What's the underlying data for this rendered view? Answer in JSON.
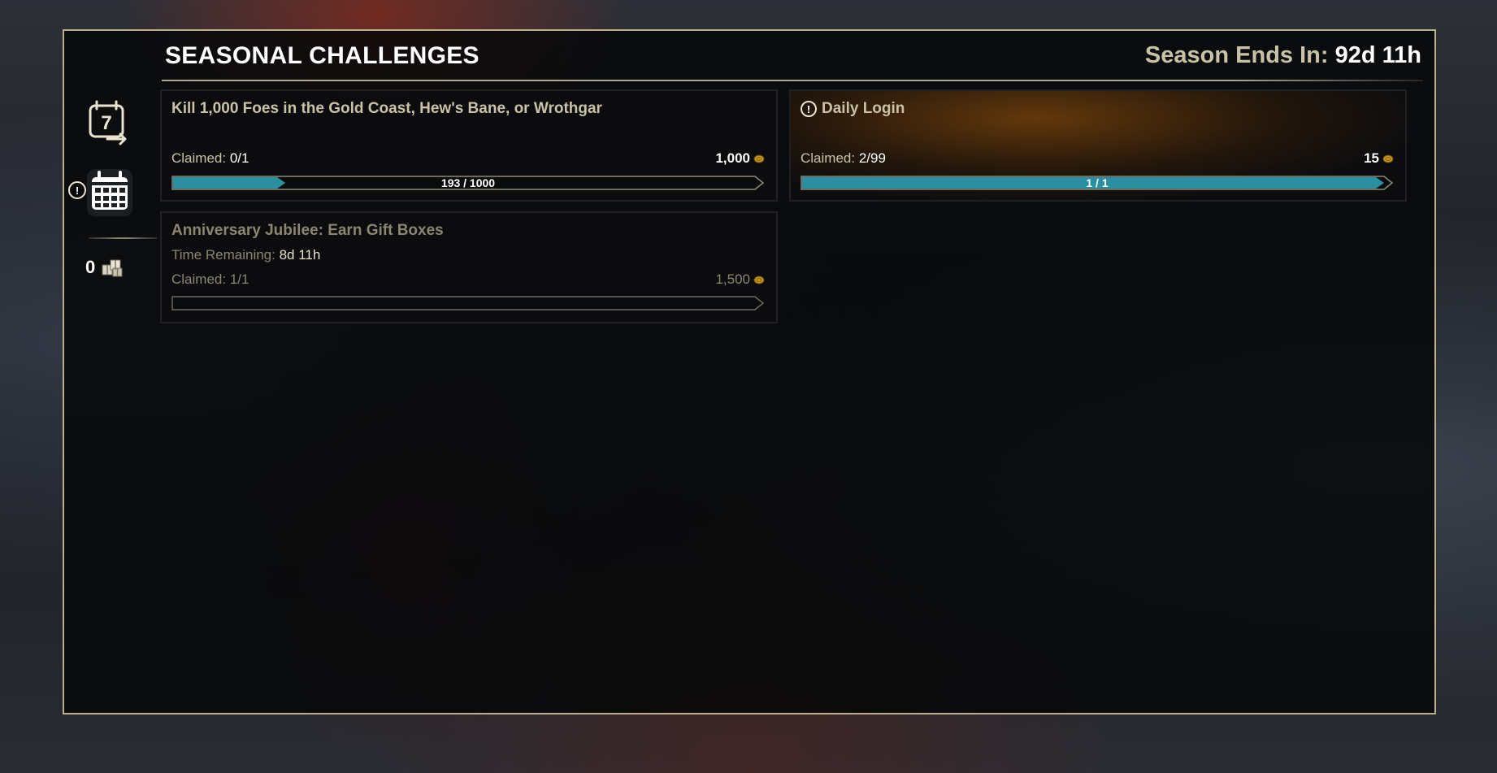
{
  "header": {
    "title": "SEASONAL CHALLENGES",
    "season_label": "Season Ends In:",
    "season_value": "92d 11h"
  },
  "sidebar": {
    "weekly_icon": "calendar-7-icon",
    "weekly_number": "7",
    "daily_icon": "calendar-grid-icon",
    "alert_icon": "exclamation-icon",
    "alert_glyph": "!",
    "currency_count": "0",
    "currency_icon": "gift-boxes-icon"
  },
  "challenges": [
    {
      "title": "Kill 1,000 Foes in the Gold Coast, Hew's Bane, or Wrothgar",
      "claimed_label": "Claimed:",
      "claimed_value": "0/1",
      "reward": "1,000",
      "progress_text": "193 / 1000",
      "progress": 0.193,
      "state": "active"
    },
    {
      "title": "Daily Login",
      "title_icon": "exclamation-icon",
      "title_icon_glyph": "!",
      "claimed_label": "Claimed:",
      "claimed_value": "2/99",
      "reward": "15",
      "progress_text": "1 / 1",
      "progress": 1.0,
      "state": "highlighted"
    },
    {
      "title": "Anniversary Jubilee: Earn Gift Boxes",
      "time_label": "Time Remaining:",
      "time_value": "8d 11h",
      "claimed_label": "Claimed:",
      "claimed_value": "1/1",
      "reward": "1,500",
      "progress": 0,
      "state": "completed"
    }
  ],
  "colors": {
    "frame_border": "#b9b08b",
    "text_gold": "#c9c2a6",
    "bar_fill": "#2a8fa0",
    "coin": "#c8961e"
  }
}
